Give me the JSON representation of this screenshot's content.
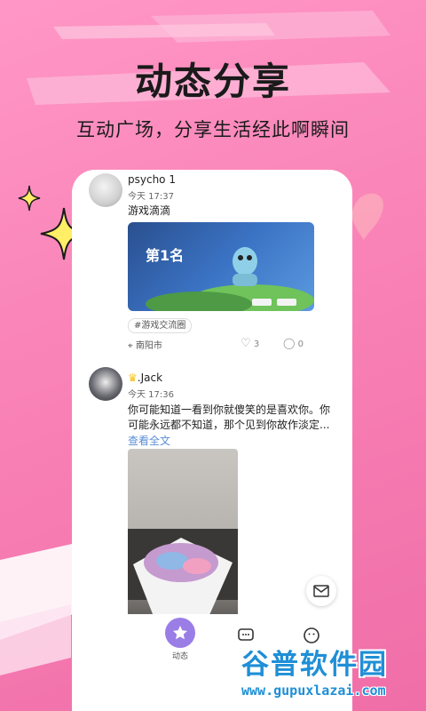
{
  "promo": {
    "headline": "动态分享",
    "subline": "互动广场，分享生活经此啊瞬间"
  },
  "feed": {
    "posts": [
      {
        "username": "psycho 1",
        "timestamp": "今天 17:37",
        "text": "游戏滴滴",
        "game_rank": "第1名",
        "tag": "#游戏交流圈",
        "location": "南阳市",
        "likes": "3",
        "comments": "0"
      },
      {
        "username": ".Jack",
        "timestamp": "今天 17:36",
        "text_line1": "你可能知道一看到你就傻笑的是喜欢你。你",
        "text_line2": "可能永远都不知道，那个见到你故作淡定...",
        "read_more": "查看全文"
      }
    ]
  },
  "tabbar": {
    "tabs": [
      {
        "label": "动态",
        "icon": "star-icon",
        "active": true
      },
      {
        "label": "",
        "icon": "message-icon",
        "active": false
      },
      {
        "label": "",
        "icon": "smiley-icon",
        "active": false
      }
    ]
  },
  "watermark": {
    "title": "谷普软件园",
    "url": "www.gupuxlazai.com"
  },
  "colors": {
    "background": "#f982b6",
    "accent": "#9b7de6",
    "link": "#5a8dd6",
    "watermark": "#1f8fd6"
  }
}
